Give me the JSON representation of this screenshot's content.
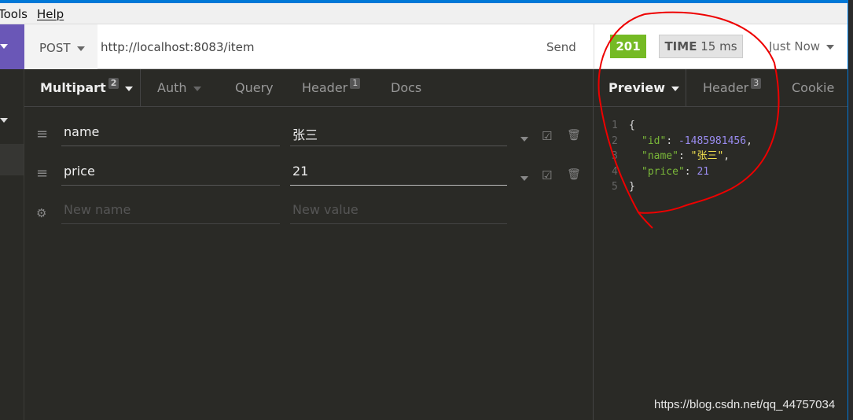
{
  "menu": {
    "items": [
      "Tools",
      "Help"
    ],
    "first_visible": "ools",
    "first_prefix": "T"
  },
  "request": {
    "method": "POST",
    "url": "http://localhost:8083/item",
    "send_label": "Send"
  },
  "request_tabs": [
    {
      "label": "Multipart",
      "badge": "2"
    },
    {
      "label": "Auth"
    },
    {
      "label": "Query"
    },
    {
      "label": "Header",
      "badge": "1"
    },
    {
      "label": "Docs"
    }
  ],
  "params": [
    {
      "name": "name",
      "value": "张三"
    },
    {
      "name": "price",
      "value": "21"
    }
  ],
  "new_param": {
    "name_placeholder": "New name",
    "value_placeholder": "New value"
  },
  "response": {
    "status": "201",
    "time_label": "TIME",
    "time_value": "15 ms",
    "when": "Just Now",
    "status_color": "#75ba24"
  },
  "response_tabs": [
    {
      "label": "Preview"
    },
    {
      "label": "Header",
      "badge": "3"
    },
    {
      "label": "Cookie"
    }
  ],
  "body": {
    "lines": [
      "1",
      "2",
      "3",
      "4",
      "5"
    ],
    "id_key": "\"id\"",
    "id_val": "-1485981456",
    "name_key": "\"name\"",
    "name_val": "\"张三\"",
    "price_key": "\"price\"",
    "price_val": "21"
  },
  "watermark": "https://blog.csdn.net/qq_44757034"
}
